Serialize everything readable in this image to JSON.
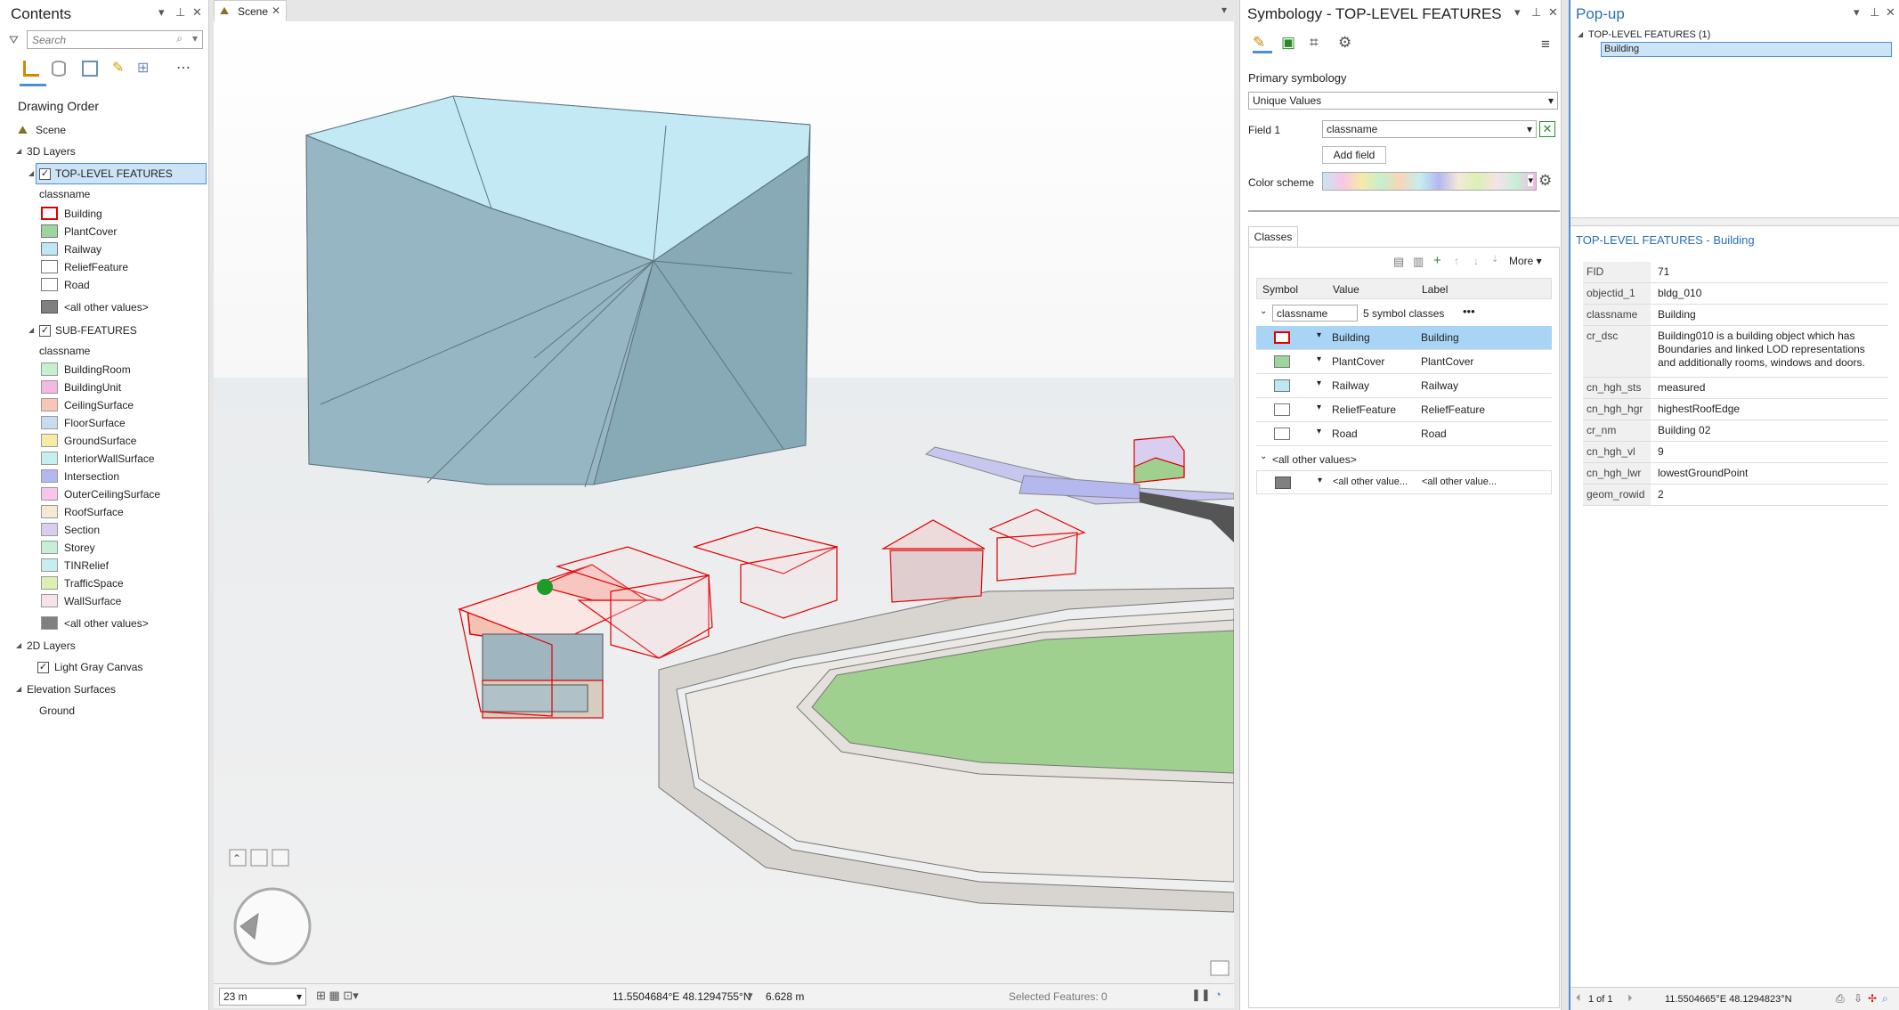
{
  "contents": {
    "title": "Contents",
    "search_placeholder": "Search",
    "drawing_order": "Drawing Order",
    "scene": "Scene",
    "layers_3d": "3D Layers",
    "top_layer": "TOP-LEVEL FEATURES",
    "top_field": "classname",
    "top_classes": [
      {
        "label": "Building",
        "color": "#ffffff",
        "border": "#e00000"
      },
      {
        "label": "PlantCover",
        "color": "#9fd49f",
        "border": "#777"
      },
      {
        "label": "Railway",
        "color": "#bfe6f4",
        "border": "#777"
      },
      {
        "label": "ReliefFeature",
        "color": "#ffffff",
        "border": "#777"
      },
      {
        "label": "Road",
        "color": "#ffffff",
        "border": "#777"
      },
      {
        "label": "<all other values>",
        "color": "#808080",
        "border": "#555"
      }
    ],
    "sub_layer": "SUB-FEATURES",
    "sub_field": "classname",
    "sub_classes": [
      {
        "label": "BuildingRoom",
        "color": "#c6efce"
      },
      {
        "label": "BuildingUnit",
        "color": "#f4b8e4"
      },
      {
        "label": "CeilingSurface",
        "color": "#f7c6b6"
      },
      {
        "label": "FloorSurface",
        "color": "#c8dcf0"
      },
      {
        "label": "GroundSurface",
        "color": "#f7e9a6"
      },
      {
        "label": "InteriorWallSurface",
        "color": "#c6f0ef"
      },
      {
        "label": "Intersection",
        "color": "#b4b8f0"
      },
      {
        "label": "OuterCeilingSurface",
        "color": "#f7c6e8"
      },
      {
        "label": "RoofSurface",
        "color": "#f5e9d6"
      },
      {
        "label": "Section",
        "color": "#d9cdf0"
      },
      {
        "label": "Storey",
        "color": "#c6efd7"
      },
      {
        "label": "TINRelief",
        "color": "#c6eef0"
      },
      {
        "label": "TrafficSpace",
        "color": "#dcf0b4"
      },
      {
        "label": "WallSurface",
        "color": "#f7e1ea"
      },
      {
        "label": "<all other values>",
        "color": "#808080"
      }
    ],
    "layers_2d": "2D Layers",
    "basemap": "Light Gray Canvas",
    "elevation": "Elevation Surfaces",
    "ground": "Ground"
  },
  "scene": {
    "tab_label": "Scene",
    "scale": "23 m",
    "coords": "11.5504684°E 48.1294755°N",
    "elevation": "6.628 m",
    "selected": "Selected Features: 0"
  },
  "symbology": {
    "title": "Symbology - TOP-LEVEL FEATURES",
    "primary": "Primary symbology",
    "method": "Unique Values",
    "field1_label": "Field 1",
    "field1_value": "classname",
    "add_field": "Add field",
    "color_scheme_label": "Color scheme",
    "classes_tab": "Classes",
    "more": "More",
    "col_symbol": "Symbol",
    "col_value": "Value",
    "col_label": "Label",
    "group_field": "classname",
    "group_count": "5 symbol classes",
    "rows": [
      {
        "value": "Building",
        "label": "Building",
        "color": "#ffffff",
        "border": "#e00000"
      },
      {
        "value": "PlantCover",
        "label": "PlantCover",
        "color": "#9fd49f",
        "border": "#777"
      },
      {
        "value": "Railway",
        "label": "Railway",
        "color": "#bfe6f4",
        "border": "#777"
      },
      {
        "value": "ReliefFeature",
        "label": "ReliefFeature",
        "color": "#ffffff",
        "border": "#777"
      },
      {
        "value": "Road",
        "label": "Road",
        "color": "#ffffff",
        "border": "#777"
      }
    ],
    "other_group": "<all other values>",
    "other_value": "<all other value...",
    "other_label": "<all other value..."
  },
  "popup": {
    "title": "Pop-up",
    "tree_layer": "TOP-LEVEL FEATURES (1)",
    "tree_item": "Building",
    "detail_title": "TOP-LEVEL FEATURES - Building",
    "rows": [
      {
        "k": "FID",
        "v": "71"
      },
      {
        "k": "objectid_1",
        "v": "bldg_010"
      },
      {
        "k": "classname",
        "v": "Building"
      },
      {
        "k": "cr_dsc",
        "v": "Building010 is a building object which has Boundaries and linked LOD representations and additionally rooms, windows and doors."
      },
      {
        "k": "cn_hgh_sts",
        "v": "measured"
      },
      {
        "k": "cn_hgh_hgr",
        "v": "highestRoofEdge"
      },
      {
        "k": "cr_nm",
        "v": "Building 02"
      },
      {
        "k": "cn_hgh_vl",
        "v": "9"
      },
      {
        "k": "cn_hgh_lwr",
        "v": "lowestGroundPoint"
      },
      {
        "k": "geom_rowid",
        "v": "2"
      }
    ],
    "pager": "1 of 1",
    "coords": "11.5504665°E 48.1294823°N"
  },
  "colors": {
    "accent": "#4a90d9",
    "selection": "#a8d4f5",
    "building_outline": "#e00000"
  }
}
